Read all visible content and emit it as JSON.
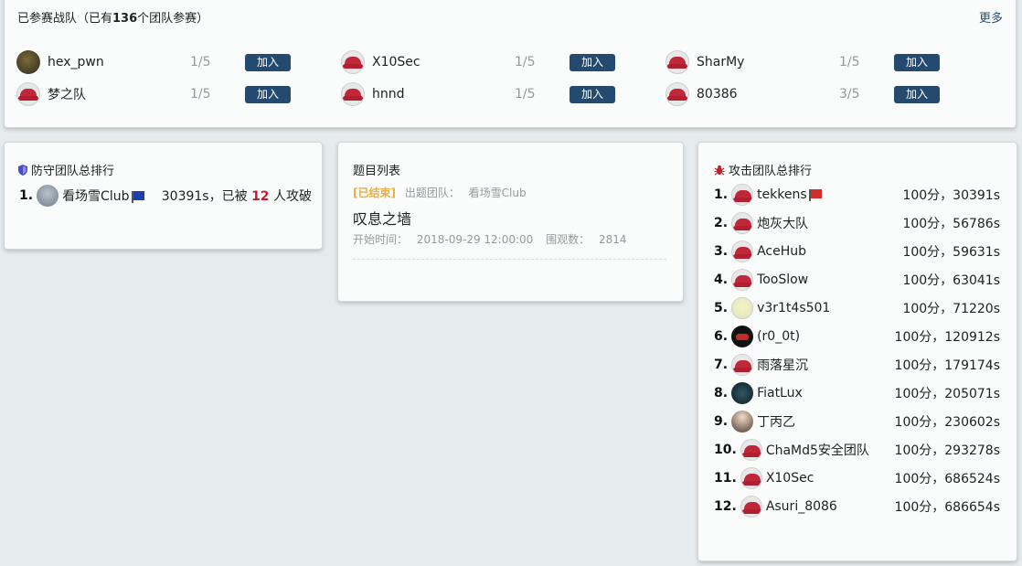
{
  "teams": {
    "title_prefix": "已参赛战队（已有",
    "title_count": "136",
    "title_suffix": "个团队参赛）",
    "more_label": "更多",
    "join_label": "加入",
    "items": [
      {
        "name": "hex_pwn",
        "count": "1/5",
        "avatar": "photo"
      },
      {
        "name": "X10Sec",
        "count": "1/5",
        "avatar": "redhat"
      },
      {
        "name": "SharMy",
        "count": "1/5",
        "avatar": "redhat"
      },
      {
        "name": "梦之队",
        "count": "1/5",
        "avatar": "redhat"
      },
      {
        "name": "hnnd",
        "count": "1/5",
        "avatar": "redhat"
      },
      {
        "name": "80386",
        "count": "3/5",
        "avatar": "redhat"
      }
    ]
  },
  "defense": {
    "title": "防守团队总排行",
    "rank": "1.",
    "team": "看场雪Club",
    "time_prefix": "30391s，已被",
    "attacked_count": "12",
    "time_suffix": "人攻破",
    "flag_color": "#1c3fa8"
  },
  "problems": {
    "title": "题目列表",
    "status": "[已结束]",
    "author_label": "出题团队：",
    "author": "看场雪Club",
    "problem_name": "叹息之墙",
    "start_label": "开始时间：",
    "start_time": "2018-09-29 12:00:00",
    "views_label": "围观数：",
    "views": "2814",
    "status_color": "#e8b040"
  },
  "attack": {
    "title": "攻击团队总排行",
    "rows": [
      {
        "rank": "1.",
        "name": "tekkens",
        "score": "100分，30391s",
        "avatar": "redhat",
        "flag": "red"
      },
      {
        "rank": "2.",
        "name": "炮灰大队",
        "score": "100分，56786s",
        "avatar": "redhat",
        "flag": ""
      },
      {
        "rank": "3.",
        "name": "AceHub",
        "score": "100分，59631s",
        "avatar": "redhat",
        "flag": ""
      },
      {
        "rank": "4.",
        "name": "TooSlow",
        "score": "100分，63041s",
        "avatar": "redhat",
        "flag": ""
      },
      {
        "rank": "5.",
        "name": "v3r1t4s501",
        "score": "100分，71220s",
        "avatar": "anime",
        "flag": ""
      },
      {
        "rank": "6.",
        "name": "(r0_0t)",
        "score": "100分，120912s",
        "avatar": "black",
        "flag": ""
      },
      {
        "rank": "7.",
        "name": "雨落星沉",
        "score": "100分，179174s",
        "avatar": "redhat",
        "flag": ""
      },
      {
        "rank": "8.",
        "name": "FiatLux",
        "score": "100分，205071s",
        "avatar": "dark",
        "flag": ""
      },
      {
        "rank": "9.",
        "name": "丁丙乙",
        "score": "100分，230602s",
        "avatar": "girl",
        "flag": ""
      },
      {
        "rank": "10.",
        "name": "ChaMd5安全团队",
        "score": "100分，293278s",
        "avatar": "redhat",
        "flag": ""
      },
      {
        "rank": "11.",
        "name": "X10Sec",
        "score": "100分，686524s",
        "avatar": "redhat",
        "flag": ""
      },
      {
        "rank": "12.",
        "name": "Asuri_8086",
        "score": "100分，686654s",
        "avatar": "redhat",
        "flag": ""
      }
    ]
  },
  "colors": {
    "accent": "#244a70",
    "danger": "#c0202a",
    "background": "#e6eced"
  }
}
